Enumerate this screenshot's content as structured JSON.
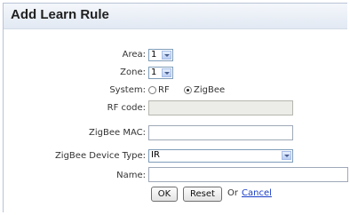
{
  "dialog": {
    "title": "Add Learn Rule"
  },
  "form": {
    "area": {
      "label": "Area:",
      "value": "1"
    },
    "zone": {
      "label": "Zone:",
      "value": "1"
    },
    "system": {
      "label": "System:",
      "options": [
        {
          "label": "RF",
          "selected": false
        },
        {
          "label": "ZigBee",
          "selected": true
        }
      ]
    },
    "rf_code": {
      "label": "RF code:",
      "value": "",
      "disabled": true
    },
    "zigbee_mac": {
      "label": "ZigBee MAC:",
      "value": ""
    },
    "zigbee_device_type": {
      "label": "ZigBee Device Type:",
      "value": "IR"
    },
    "name": {
      "label": "Name:",
      "value": ""
    }
  },
  "actions": {
    "ok_label": "OK",
    "reset_label": "Reset",
    "or_text": "Or",
    "cancel_label": "Cancel"
  },
  "colors": {
    "link": "#1a3ec8",
    "title_bg": "#e2e9f3"
  }
}
